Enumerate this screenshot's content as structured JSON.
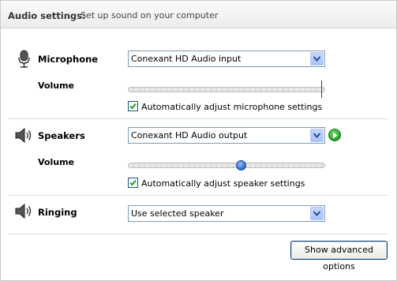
{
  "header": {
    "title": "Audio settings:",
    "subtitle": "Set up sound on your computer"
  },
  "microphone": {
    "label": "Microphone",
    "device": "Conexant HD Audio input",
    "volume_label": "Volume",
    "volume_level": 1.0,
    "auto_adjust_label": "Automatically adjust microphone settings",
    "auto_adjust_checked": true
  },
  "speakers": {
    "label": "Speakers",
    "device": "Conexant HD Audio output",
    "volume_label": "Volume",
    "volume_level": 0.58,
    "auto_adjust_label": "Automatically adjust speaker settings",
    "auto_adjust_checked": true
  },
  "ringing": {
    "label": "Ringing",
    "device": "Use selected speaker"
  },
  "footer": {
    "advanced_button": "Show advanced options"
  },
  "icons": {
    "microphone": "microphone-icon",
    "speakers": "speaker-icon",
    "ringing": "speaker-icon",
    "play": "play-icon",
    "dropdown": "chevron-down-icon"
  },
  "colors": {
    "accent": "#2d66c8",
    "play": "#1f9a1f"
  }
}
